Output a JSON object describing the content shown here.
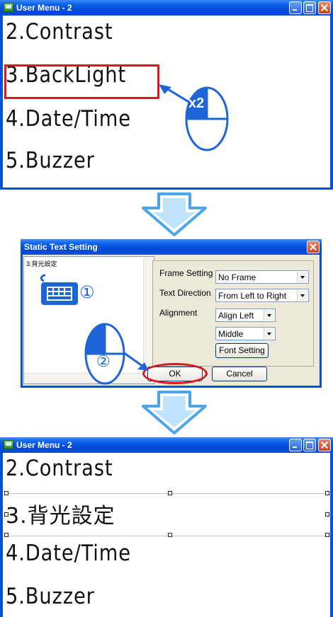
{
  "window_top": {
    "title": "User Menu - 2",
    "items": [
      "2.Contrast",
      "3.BackLight",
      "4.Date/Time",
      "5.Buzzer"
    ],
    "double_click_badge": "x2"
  },
  "dialog": {
    "title": "Static Text Setting",
    "preview_text": "3.背光設定",
    "step1": "①",
    "step2": "②",
    "frame_setting_label": "Frame Setting",
    "frame_setting_value": "No Frame",
    "text_direction_label": "Text Direction",
    "text_direction_value": "From Left to Right",
    "alignment_label": "Alignment",
    "alignment_value": "Align Left",
    "vertical_value": "Middle",
    "font_button": "Font Setting",
    "ok_button": "OK",
    "cancel_button": "Cancel"
  },
  "window_bottom": {
    "title": "User Menu - 2",
    "items": [
      "2.Contrast",
      "3.背光設定",
      "4.Date/Time",
      "5.Buzzer"
    ]
  },
  "colors": {
    "xp_blue": "#0a4fd8",
    "highlight_red": "#e0141e",
    "flow_arrow": "#4aa6e8",
    "pointer_blue": "#1e64d6"
  }
}
